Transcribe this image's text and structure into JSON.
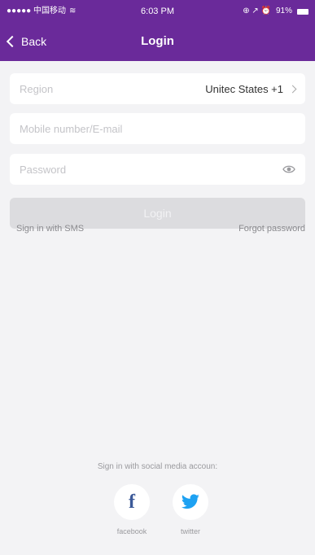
{
  "status_bar": {
    "carrier": "●●●●● 中国移动",
    "wifi": "≋",
    "time": "6:03 PM",
    "right_icons": "⊕ ↗ ⏰",
    "battery": "91%"
  },
  "nav": {
    "back_label": "Back",
    "title": "Login"
  },
  "form": {
    "region_label": "Region",
    "region_value": "Unitec States +1",
    "mobile_placeholder": "Mobile number/E-mail",
    "password_placeholder": "Password",
    "login_label": "Login"
  },
  "links": {
    "sms": "Sign in with SMS",
    "forgot": "Forgot password"
  },
  "social": {
    "caption": "Sign in with social media accoun:",
    "facebook_label": "facebook",
    "twitter_label": "twitter"
  },
  "colors": {
    "header": "#6a2a9a",
    "background": "#f3f3f5",
    "facebook": "#3b5998",
    "twitter": "#1da1f2"
  }
}
